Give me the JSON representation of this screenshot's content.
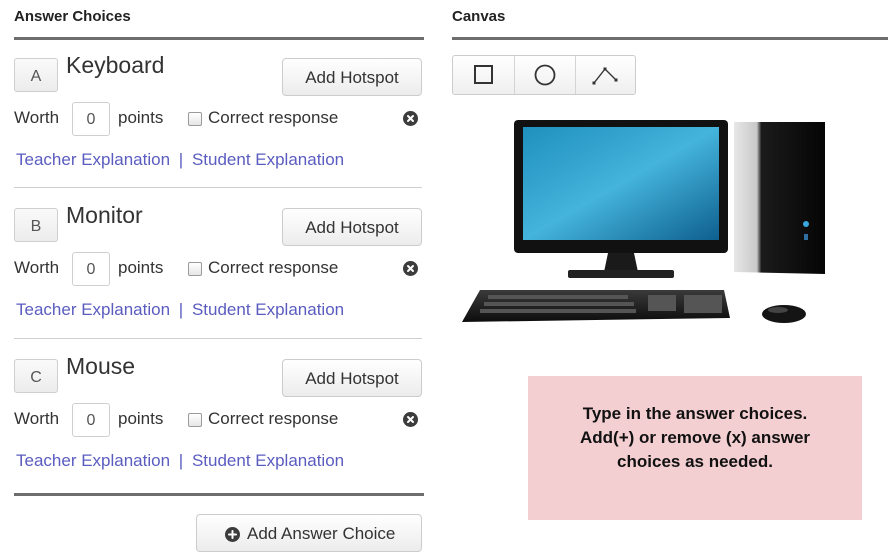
{
  "answer_panel": {
    "title": "Answer Choices",
    "choices": [
      {
        "letter": "A",
        "name": "Keyboard",
        "hotspot_label": "Add Hotspot",
        "worth_label": "Worth",
        "points": "0",
        "points_label": "points",
        "correct_label": "Correct response",
        "correct_checked": false,
        "teacher_link": "Teacher Explanation",
        "separator": "|",
        "student_link": "Student Explanation"
      },
      {
        "letter": "B",
        "name": "Monitor",
        "hotspot_label": "Add Hotspot",
        "worth_label": "Worth",
        "points": "0",
        "points_label": "points",
        "correct_label": "Correct response",
        "correct_checked": false,
        "teacher_link": "Teacher Explanation",
        "separator": "|",
        "student_link": "Student Explanation"
      },
      {
        "letter": "C",
        "name": "Mouse",
        "hotspot_label": "Add Hotspot",
        "worth_label": "Worth",
        "points": "0",
        "points_label": "points",
        "correct_label": "Correct response",
        "correct_checked": false,
        "teacher_link": "Teacher Explanation",
        "separator": "|",
        "student_link": "Student Explanation"
      }
    ],
    "add_choice_label": "Add Answer Choice"
  },
  "canvas_panel": {
    "title": "Canvas",
    "tools": [
      {
        "icon": "rectangle-icon"
      },
      {
        "icon": "circle-icon"
      },
      {
        "icon": "polyline-icon"
      }
    ],
    "image_icon": "desktop-computer-image",
    "hint": [
      "Type in the answer choices.",
      "Add(+) or remove (x) answer",
      "choices as needed."
    ]
  },
  "colors": {
    "link": "#5a5cc0",
    "hint_bg": "#f4cfd2",
    "rule": "#6d6d6d"
  }
}
